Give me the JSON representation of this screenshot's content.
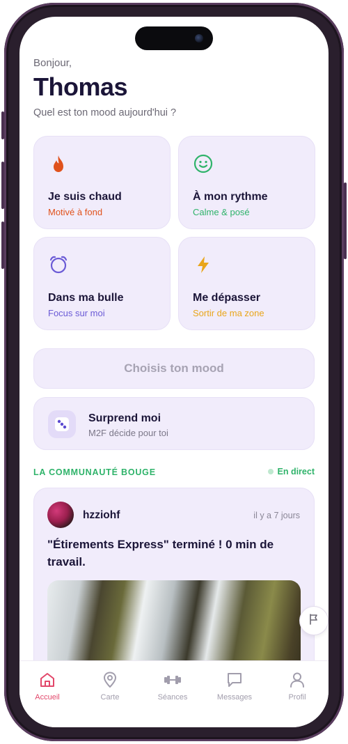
{
  "header": {
    "greeting": "Bonjour,",
    "name": "Thomas",
    "question": "Quel est ton mood aujourd'hui ?"
  },
  "moods": [
    {
      "title": "Je suis chaud",
      "subtitle": "Motivé à fond",
      "icon": "flame-icon",
      "color": "#e0521c"
    },
    {
      "title": "À mon rythme",
      "subtitle": "Calme & posé",
      "icon": "smile-icon",
      "color": "#2fb36a"
    },
    {
      "title": "Dans ma bulle",
      "subtitle": "Focus sur moi",
      "icon": "alarm-clock-icon",
      "color": "#6b5bd6"
    },
    {
      "title": "Me dépasser",
      "subtitle": "Sortir de ma zone",
      "icon": "lightning-icon",
      "color": "#e9a61b"
    }
  ],
  "choose_button": "Choisis ton mood",
  "surprise": {
    "title": "Surprend moi",
    "subtitle": "M2F décide pour toi",
    "icon": "dice-icon"
  },
  "community": {
    "title": "LA COMMUNAUTÉ BOUGE",
    "live_label": "En direct"
  },
  "post": {
    "username": "hzziohf",
    "time": "il y a 7 jours",
    "text": "\"Étirements Express\" terminé ! 0 min de travail."
  },
  "tabs": [
    {
      "label": "Accueil",
      "icon": "home-icon",
      "active": true
    },
    {
      "label": "Carte",
      "icon": "map-pin-icon",
      "active": false
    },
    {
      "label": "Séances",
      "icon": "dumbbell-icon",
      "active": false
    },
    {
      "label": "Messages",
      "icon": "chat-icon",
      "active": false
    },
    {
      "label": "Profil",
      "icon": "user-icon",
      "active": false
    }
  ],
  "colors": {
    "accent": "#e2476a",
    "card_bg": "#f1ecfb",
    "live": "#2fb36a",
    "title": "#1b1538"
  }
}
